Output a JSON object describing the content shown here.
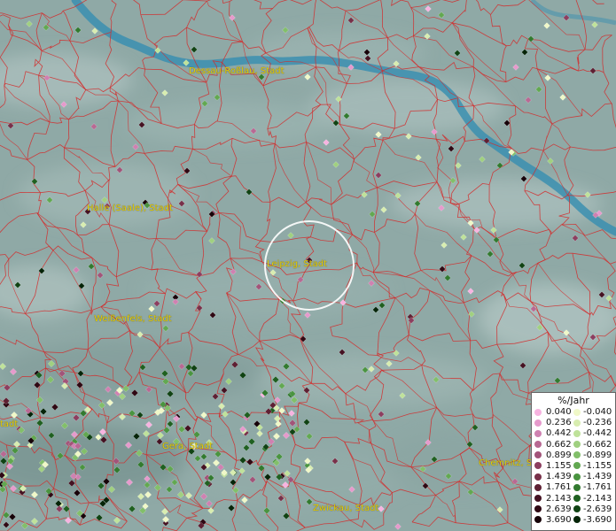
{
  "map": {
    "cities": [
      {
        "name": "Dessau-Roßlau, Stadt"
      },
      {
        "name": "Halle (Saale), Stadt"
      },
      {
        "name": "Leipzig, Stadt"
      },
      {
        "name": "Weißenfels, Stadt"
      },
      {
        "name": "Gera, Stadt"
      },
      {
        "name": "Zwickau, Stadt"
      },
      {
        "name": "Chemnitz, S"
      },
      {
        "name": "tadt"
      }
    ]
  },
  "legend": {
    "title": "%/Jahr",
    "positive": [
      "0.040",
      "0.236",
      "0.442",
      "0.662",
      "0.899",
      "1.155",
      "1.439",
      "1.761",
      "2.143",
      "2.639",
      "3.690"
    ],
    "negative": [
      "-0.040",
      "-0.236",
      "-0.442",
      "-0.662",
      "-0.899",
      "-1.155",
      "-1.439",
      "-1.761",
      "-2.143",
      "-2.639",
      "-3.690"
    ],
    "positive_colors": [
      "#f7b3e0",
      "#e69acc",
      "#cf81b1",
      "#b86993",
      "#a25479",
      "#8c3e5f",
      "#783049",
      "#5e2033",
      "#451222",
      "#2f0813",
      "#160208"
    ],
    "negative_colors": [
      "#f0f8c8",
      "#d8edb0",
      "#bfe29a",
      "#a0d080",
      "#82bf6a",
      "#62a851",
      "#4a9440",
      "#327a2f",
      "#1f6020",
      "#104313",
      "#052408"
    ]
  },
  "colors": {
    "river": "#3b8fb0",
    "boundary": "#d42a2a",
    "label": "#e8d000",
    "circle": "#ffffff"
  }
}
